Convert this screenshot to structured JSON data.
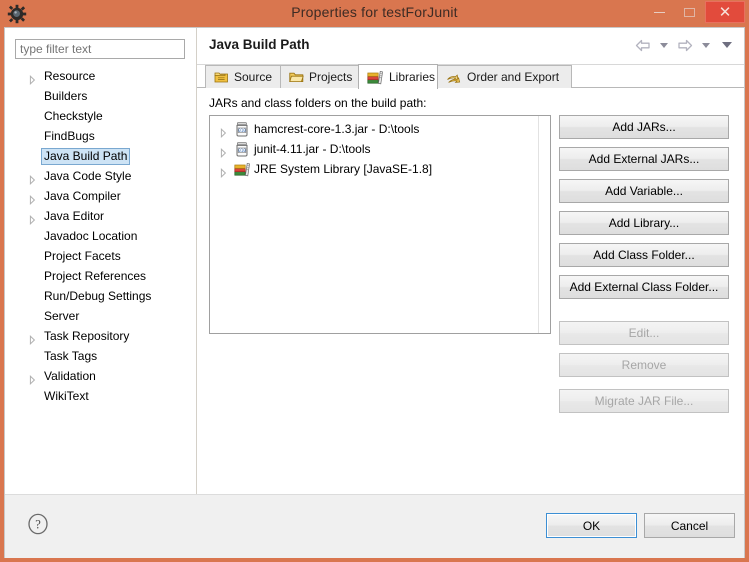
{
  "window": {
    "title": "Properties for testForJunit",
    "icon": "gear-icon",
    "minimize_label": "Minimize",
    "maximize_label": "Maximize",
    "close_label": "Close",
    "titlebar_color": "#d9764f",
    "close_button_color": "#e24b3c"
  },
  "sidebar": {
    "filter": {
      "placeholder": "type filter text",
      "value": ""
    },
    "selection_color": "#cde3f5",
    "items": [
      {
        "label": "Resource",
        "expandable": true,
        "selected": false
      },
      {
        "label": "Builders",
        "expandable": false,
        "selected": false
      },
      {
        "label": "Checkstyle",
        "expandable": false,
        "selected": false
      },
      {
        "label": "FindBugs",
        "expandable": false,
        "selected": false
      },
      {
        "label": "Java Build Path",
        "expandable": false,
        "selected": true
      },
      {
        "label": "Java Code Style",
        "expandable": true,
        "selected": false
      },
      {
        "label": "Java Compiler",
        "expandable": true,
        "selected": false
      },
      {
        "label": "Java Editor",
        "expandable": true,
        "selected": false
      },
      {
        "label": "Javadoc Location",
        "expandable": false,
        "selected": false
      },
      {
        "label": "Project Facets",
        "expandable": false,
        "selected": false
      },
      {
        "label": "Project References",
        "expandable": false,
        "selected": false
      },
      {
        "label": "Run/Debug Settings",
        "expandable": false,
        "selected": false
      },
      {
        "label": "Server",
        "expandable": false,
        "selected": false
      },
      {
        "label": "Task Repository",
        "expandable": true,
        "selected": false
      },
      {
        "label": "Task Tags",
        "expandable": false,
        "selected": false
      },
      {
        "label": "Validation",
        "expandable": true,
        "selected": false
      },
      {
        "label": "WikiText",
        "expandable": false,
        "selected": false
      }
    ]
  },
  "panel": {
    "title": "Java Build Path",
    "nav": {
      "back": "back-arrow",
      "back_menu": "back-dropdown",
      "forward": "forward-arrow",
      "forward_menu": "forward-dropdown",
      "menu": "view-menu"
    },
    "tabs": [
      {
        "label": "Source",
        "icon": "source-package-icon",
        "active": false
      },
      {
        "label": "Projects",
        "icon": "folder-icon",
        "active": false
      },
      {
        "label": "Libraries",
        "icon": "library-books-icon",
        "active": true
      },
      {
        "label": "Order and Export",
        "icon": "order-export-icon",
        "active": false
      }
    ],
    "content": {
      "label": "JARs and class folders on the build path:",
      "entries": [
        {
          "name": "hamcrest-core-1.3.jar - D:\\tools",
          "icon": "jar-icon",
          "expandable": true
        },
        {
          "name": "junit-4.11.jar - D:\\tools",
          "icon": "jar-icon",
          "expandable": true
        },
        {
          "name": "JRE System Library [JavaSE-1.8]",
          "icon": "library-books-icon",
          "expandable": true
        }
      ]
    },
    "buttons": [
      {
        "label": "Add JARs...",
        "enabled": true,
        "gap": "none"
      },
      {
        "label": "Add External JARs...",
        "enabled": true,
        "gap": "none"
      },
      {
        "label": "Add Variable...",
        "enabled": true,
        "gap": "none"
      },
      {
        "label": "Add Library...",
        "enabled": true,
        "gap": "none"
      },
      {
        "label": "Add Class Folder...",
        "enabled": true,
        "gap": "none"
      },
      {
        "label": "Add External Class Folder...",
        "enabled": true,
        "gap": "none"
      },
      {
        "label": "Edit...",
        "enabled": false,
        "gap": "lg"
      },
      {
        "label": "Remove",
        "enabled": false,
        "gap": "none"
      },
      {
        "label": "Migrate JAR File...",
        "enabled": false,
        "gap": "md"
      }
    ]
  },
  "footer": {
    "help_icon": "help-question-icon",
    "ok_label": "OK",
    "cancel_label": "Cancel",
    "focus_color": "#3c8fd4"
  }
}
